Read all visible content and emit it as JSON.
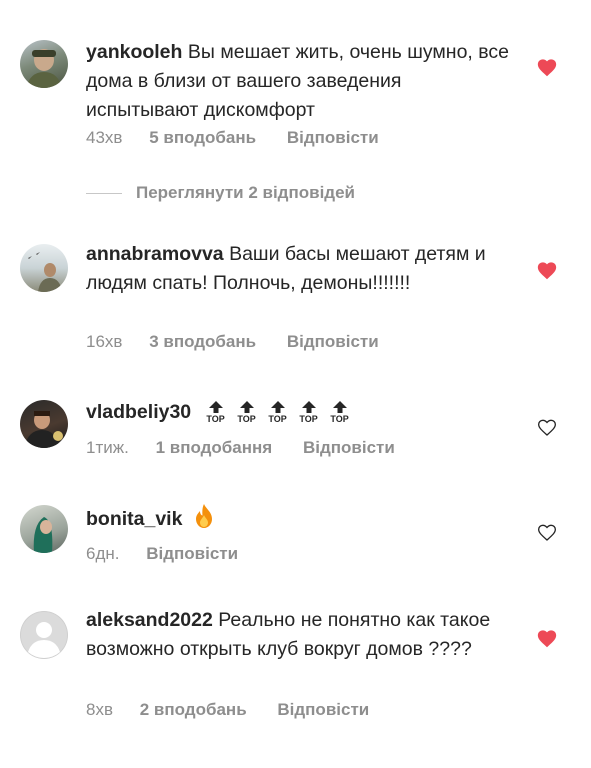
{
  "colors": {
    "heart_filled": "#ed4956",
    "meta": "#8e8e8e",
    "text": "#262626"
  },
  "replies_link": "Переглянути 2 відповідей",
  "comments": [
    {
      "username": "yankooleh",
      "text": "Вы мешает жить, очень шумно, все дома в близи от вашего заведения испытывают дискомфорт",
      "time": "43хв",
      "likes": "5 вподобань",
      "reply": "Відповісти",
      "liked": true
    },
    {
      "username": "annabramovva",
      "text": "Ваши басы мешают детям и людям спать! Полночь, демоны!!!!!!!",
      "time": "16хв",
      "likes": "3 вподобань",
      "reply": "Відповісти",
      "liked": true
    },
    {
      "username": "vladbeliy30",
      "text": "",
      "top_label": "TOP",
      "top_icon_count": 5,
      "time": "1тиж.",
      "likes": "1 вподобання",
      "reply": "Відповісти",
      "liked": false
    },
    {
      "username": "bonita_vik",
      "text": "",
      "emoji": "fire-icon",
      "time": "6дн.",
      "likes": "",
      "reply": "Відповісти",
      "liked": false
    },
    {
      "username": "aleksand2022",
      "text": "Реально не понятно как такое возможно открыть клуб вокруг домов ????",
      "time": "8хв",
      "likes": "2 вподобань",
      "reply": "Відповісти",
      "liked": true
    }
  ]
}
